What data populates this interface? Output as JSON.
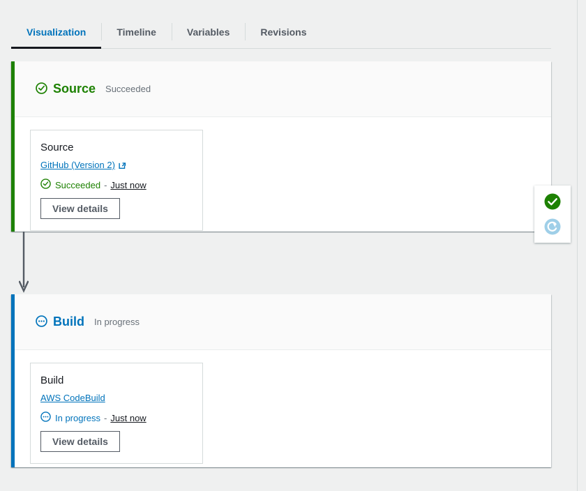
{
  "tabs": [
    {
      "label": "Visualization",
      "active": true
    },
    {
      "label": "Timeline",
      "active": false
    },
    {
      "label": "Variables",
      "active": false
    },
    {
      "label": "Revisions",
      "active": false
    }
  ],
  "stages": [
    {
      "name": "Source",
      "status": "Succeeded",
      "accent_color": "#1d8102",
      "header_icon": "check-circle-outline-icon",
      "action": {
        "name": "Source",
        "provider": "GitHub (Version 2)",
        "provider_has_external_link": true,
        "external_link_icon": "external-link-icon",
        "status": "Succeeded",
        "status_icon": "check-circle-outline-icon",
        "separator": "-",
        "time": "Just now",
        "button_label": "View details"
      }
    },
    {
      "name": "Build",
      "status": "In progress",
      "accent_color": "#0073bb",
      "header_icon": "in-progress-circle-icon",
      "action": {
        "name": "Build",
        "provider": "AWS CodeBuild",
        "provider_has_external_link": false,
        "external_link_icon": "",
        "status": "In progress",
        "status_icon": "in-progress-circle-icon",
        "separator": "-",
        "time": "Just now",
        "button_label": "View details"
      }
    }
  ],
  "float_widget": {
    "items": [
      {
        "icon": "success-filled-check-icon",
        "color": "#1d8102"
      },
      {
        "icon": "loading-spinner-icon",
        "color": "#9fcfe8"
      }
    ]
  },
  "colors": {
    "page_background": "#eff0f0",
    "panel_background": "#ffffff",
    "accent_blue": "#0073bb",
    "accent_green": "#1d8102",
    "text_secondary": "#687078",
    "connector": "#545b64"
  }
}
